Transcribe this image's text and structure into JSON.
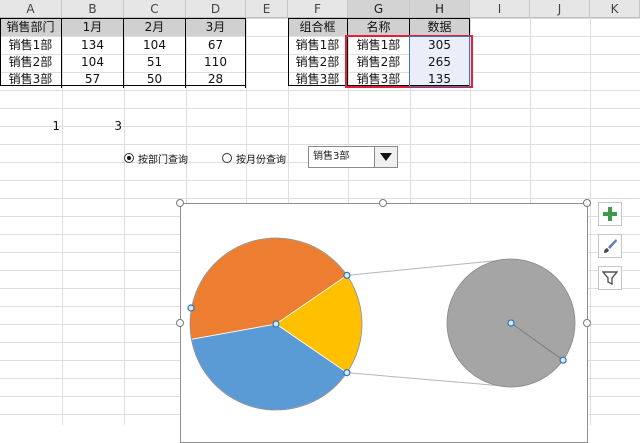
{
  "columns": [
    "A",
    "B",
    "C",
    "D",
    "E",
    "F",
    "G",
    "H",
    "I",
    "J",
    "K"
  ],
  "left_table": {
    "headers": [
      "销售部门",
      "1月",
      "2月",
      "3月"
    ],
    "rows": [
      [
        "销售1部",
        "134",
        "104",
        "67"
      ],
      [
        "销售2部",
        "104",
        "51",
        "110"
      ],
      [
        "销售3部",
        "57",
        "50",
        "28"
      ]
    ]
  },
  "right_table": {
    "headers": [
      "组合框",
      "名称",
      "数据"
    ],
    "rows": [
      [
        "销售1部",
        "销售1部",
        "305"
      ],
      [
        "销售2部",
        "销售2部",
        "265"
      ],
      [
        "销售3部",
        "销售3部",
        "135"
      ]
    ]
  },
  "loose_values": {
    "a": "1",
    "b": "3"
  },
  "controls": {
    "radio_department": "按部门查询",
    "radio_month": "按月份查询",
    "selected_radio": "按部门查询",
    "dropdown_value": "销售3部"
  },
  "colors": {
    "orange": "#ed7d31",
    "yellow": "#ffc000",
    "blue": "#5b9bd5",
    "gray": "#a5a5a5",
    "highlight": "#e0203c",
    "selection": "#4472c4"
  },
  "icons": {
    "add": "plus-icon",
    "style": "brush-icon",
    "filter": "filter-icon"
  },
  "chart_data": {
    "type": "pie",
    "subtype": "pie-of-pie",
    "categories": [
      "销售1部",
      "销售2部",
      "销售3部"
    ],
    "values": [
      305,
      265,
      135
    ],
    "secondary_plot_values": [
      135
    ]
  }
}
